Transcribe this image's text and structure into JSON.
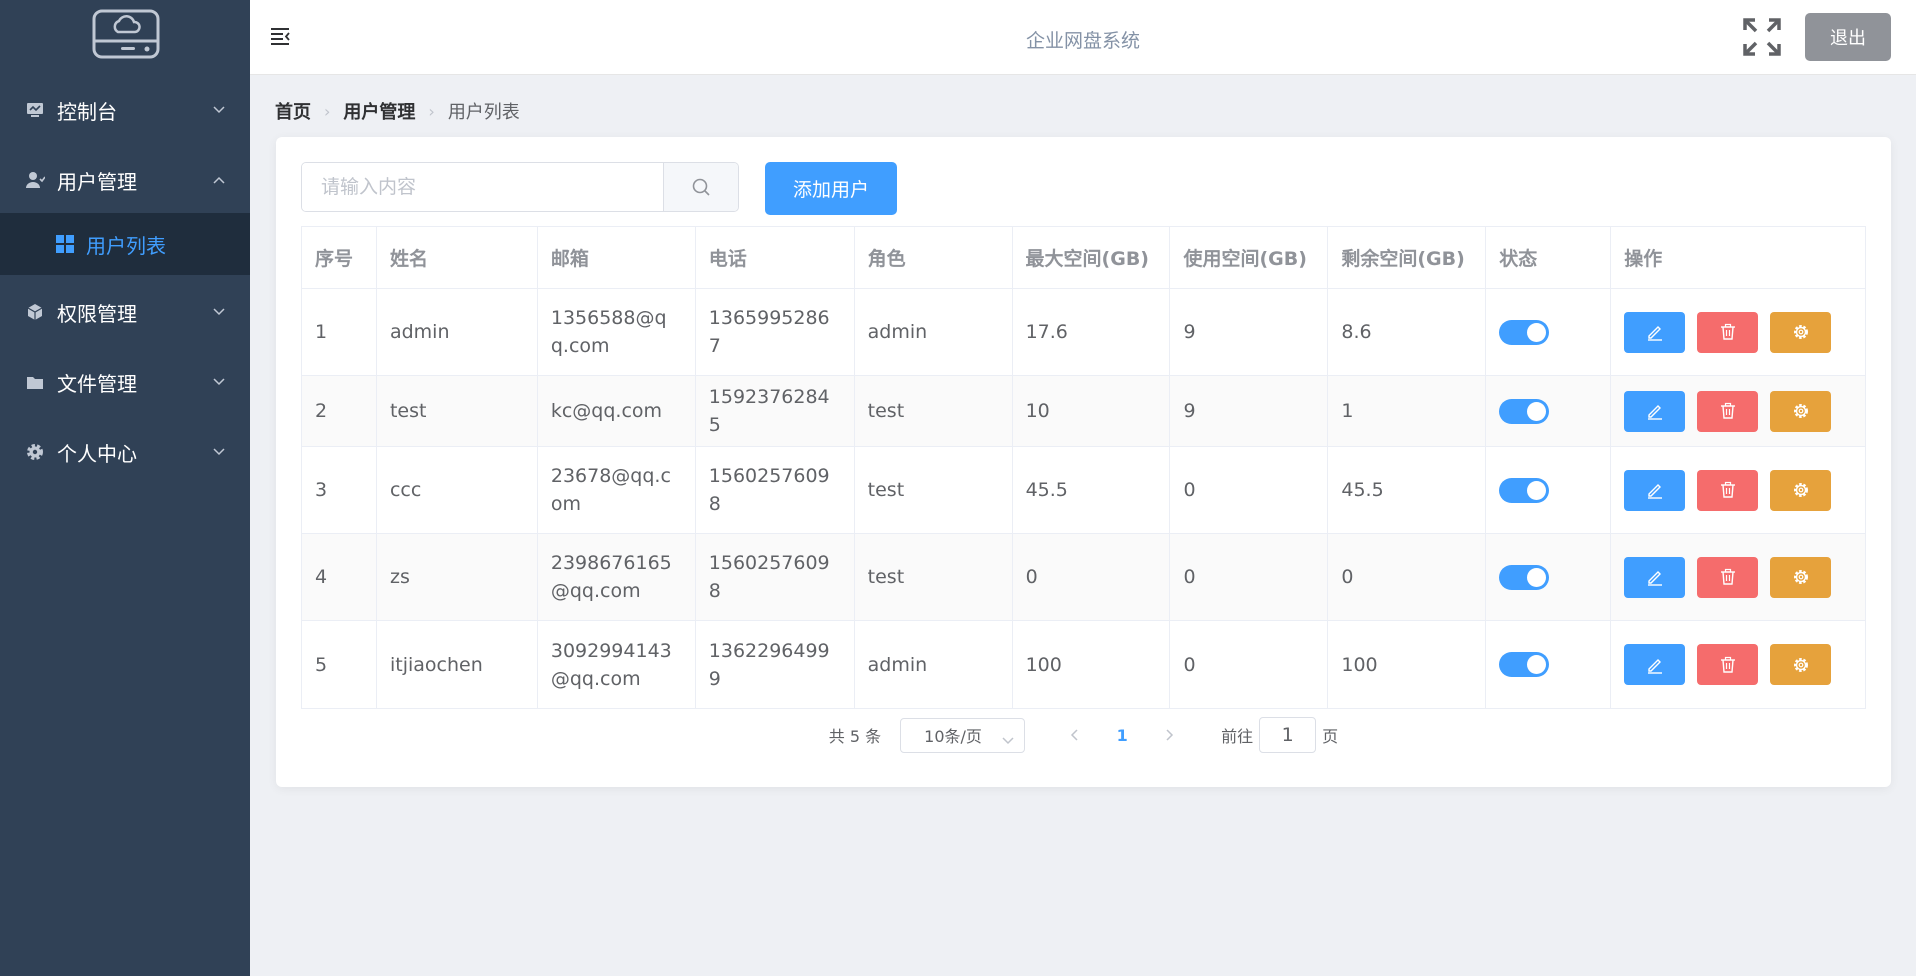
{
  "header": {
    "title": "企业网盘系统",
    "logout_label": "退出"
  },
  "sidebar": {
    "items": [
      {
        "label": "控制台",
        "icon": "monitor-icon",
        "expanded": false
      },
      {
        "label": "用户管理",
        "icon": "user-icon",
        "expanded": true
      },
      {
        "label": "权限管理",
        "icon": "cube-icon",
        "expanded": false
      },
      {
        "label": "文件管理",
        "icon": "folder-icon",
        "expanded": false
      },
      {
        "label": "个人中心",
        "icon": "gear-icon",
        "expanded": false
      }
    ],
    "active_subitem": {
      "label": "用户列表",
      "icon": "grid-icon"
    }
  },
  "breadcrumb": [
    "首页",
    "用户管理",
    "用户列表"
  ],
  "search": {
    "placeholder": "请输入内容",
    "value": ""
  },
  "add_user_label": "添加用户",
  "table": {
    "columns": [
      "序号",
      "姓名",
      "邮箱",
      "电话",
      "角色",
      "最大空间(GB)",
      "使用空间(GB)",
      "剩余空间(GB)",
      "状态",
      "操作"
    ],
    "rows": [
      {
        "id": "1",
        "name": "admin",
        "email": "1356588@qq.com",
        "phone": "13659952867",
        "role": "admin",
        "max_space": "17.6",
        "used_space": "9",
        "remaining_space": "8.6",
        "status_on": true
      },
      {
        "id": "2",
        "name": "test",
        "email": "kc@qq.com",
        "phone": "15923762845",
        "role": "test",
        "max_space": "10",
        "used_space": "9",
        "remaining_space": "1",
        "status_on": true
      },
      {
        "id": "3",
        "name": "ccc",
        "email": "23678@qq.com",
        "phone": "15602576098",
        "role": "test",
        "max_space": "45.5",
        "used_space": "0",
        "remaining_space": "45.5",
        "status_on": true
      },
      {
        "id": "4",
        "name": "zs",
        "email": "2398676165@qq.com",
        "phone": "15602576098",
        "role": "test",
        "max_space": "0",
        "used_space": "0",
        "remaining_space": "0",
        "status_on": true
      },
      {
        "id": "5",
        "name": "itjiaochen",
        "email": "3092994143@qq.com",
        "phone": "13622964999",
        "role": "admin",
        "max_space": "100",
        "used_space": "0",
        "remaining_space": "100",
        "status_on": true
      }
    ]
  },
  "pagination": {
    "total_label": "共 5 条",
    "page_size_label": "10条/页",
    "current_page": "1",
    "goto_label": "前往",
    "jump_value": "1",
    "page_suffix": "页"
  },
  "colors": {
    "sidebar_bg": "#304156",
    "sidebar_active_bg": "#1f2d3d",
    "primary": "#409eff",
    "danger": "#f56c6c",
    "warning": "#e6a23c",
    "info": "#909399"
  }
}
